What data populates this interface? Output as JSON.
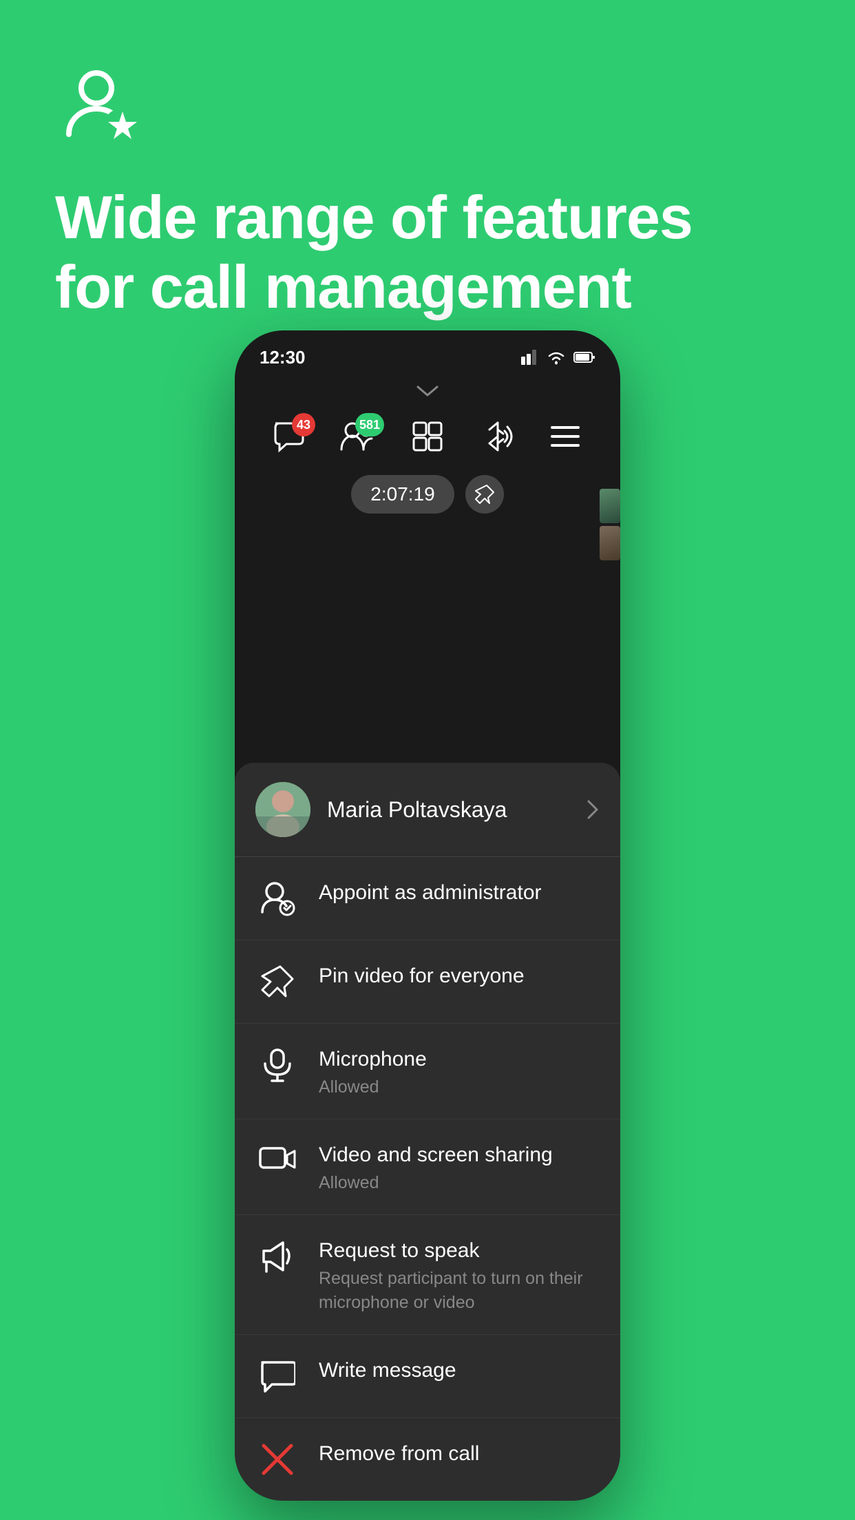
{
  "background_color": "#2ECC71",
  "top": {
    "icon_label": "admin-star-icon",
    "headline_line1": "Wide range of features",
    "headline_line2": "for call management"
  },
  "phone": {
    "status_bar": {
      "time": "12:30",
      "signal_icon": "signal-icon",
      "wifi_icon": "wifi-icon",
      "battery_icon": "battery-icon"
    },
    "toolbar": {
      "chat_badge": "43",
      "participants_badge": "581",
      "grid_icon": "grid-icon",
      "bluetooth_icon": "bluetooth-audio-icon",
      "menu_icon": "hamburger-menu-icon"
    },
    "timer": {
      "value": "2:07:19",
      "pin_icon": "pin-icon"
    },
    "context_menu": {
      "user": {
        "name": "Maria Poltavskaya",
        "chevron_icon": "chevron-right-icon"
      },
      "items": [
        {
          "id": "appoint-admin",
          "icon": "admin-appoint-icon",
          "title": "Appoint as administrator",
          "subtitle": ""
        },
        {
          "id": "pin-video",
          "icon": "pin-video-icon",
          "title": "Pin video for everyone",
          "subtitle": ""
        },
        {
          "id": "microphone",
          "icon": "microphone-icon",
          "title": "Microphone",
          "subtitle": "Allowed"
        },
        {
          "id": "video-screen",
          "icon": "video-screen-icon",
          "title": "Video and screen sharing",
          "subtitle": "Allowed"
        },
        {
          "id": "request-speak",
          "icon": "megaphone-icon",
          "title": "Request to speak",
          "subtitle": "Request participant to turn on their microphone or video"
        },
        {
          "id": "write-message",
          "icon": "message-icon",
          "title": "Write message",
          "subtitle": ""
        },
        {
          "id": "remove-call",
          "icon": "remove-icon",
          "title": "Remove from call",
          "subtitle": "",
          "title_color": "white",
          "icon_color": "#e53935"
        }
      ]
    }
  }
}
